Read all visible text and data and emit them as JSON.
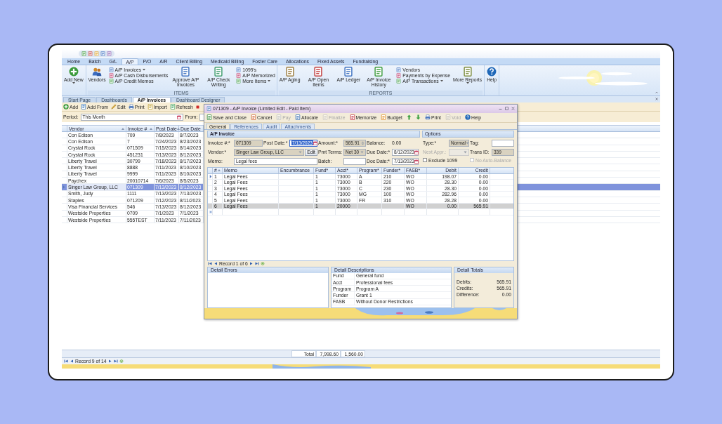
{
  "ribbon": {
    "tabs": [
      {
        "label": "Home",
        "selected": false
      },
      {
        "label": "Batch",
        "selected": false
      },
      {
        "label": "G/L",
        "selected": false
      },
      {
        "label": "A/P",
        "selected": true
      },
      {
        "label": "P/O",
        "selected": false
      },
      {
        "label": "A/R",
        "selected": false
      },
      {
        "label": "Client Billing",
        "selected": false
      },
      {
        "label": "Medicaid Billing",
        "selected": false
      },
      {
        "label": "Foster Care",
        "selected": false
      },
      {
        "label": "Allocations",
        "selected": false
      },
      {
        "label": "Fixed Assets",
        "selected": false
      },
      {
        "label": "Fundraising",
        "selected": false
      }
    ],
    "groups": [
      {
        "items": [
          {
            "kind": "large",
            "label": "Add New",
            "dropdown": true
          }
        ]
      },
      {
        "label": "ITEMS",
        "items": [
          {
            "kind": "large",
            "label": "Vendors",
            "dropdown": false
          },
          {
            "kind": "stack",
            "entries": [
              {
                "label": "A/P Invoices",
                "dropdown": true
              },
              {
                "label": "A/P Cash Disbursements",
                "dropdown": false
              },
              {
                "label": "A/P Credit Memos",
                "dropdown": false
              }
            ]
          },
          {
            "kind": "large",
            "label": "Approve A/P Invoices",
            "dropdown": false
          },
          {
            "kind": "large",
            "label": "A/P Check Writing",
            "dropdown": false
          },
          {
            "kind": "stack",
            "entries": [
              {
                "label": "1099's",
                "dropdown": false
              },
              {
                "label": "A/P Memorized",
                "dropdown": false
              },
              {
                "label": "More Items",
                "dropdown": true
              }
            ]
          }
        ]
      },
      {
        "label": "REPORTS",
        "items": [
          {
            "kind": "large",
            "label": "A/P Aging",
            "dropdown": false
          },
          {
            "kind": "large",
            "label": "A/P Open Items",
            "dropdown": false
          },
          {
            "kind": "large",
            "label": "A/P Ledger",
            "dropdown": false
          },
          {
            "kind": "large",
            "label": "A/P Invoice History",
            "dropdown": false
          },
          {
            "kind": "stack",
            "entries": [
              {
                "label": "Vendors",
                "dropdown": false
              },
              {
                "label": "Payments by Expense",
                "dropdown": false
              },
              {
                "label": "A/P Transactions",
                "dropdown": true
              }
            ]
          },
          {
            "kind": "large",
            "label": "More Reports",
            "dropdown": true
          }
        ]
      },
      {
        "items": [
          {
            "kind": "large",
            "label": "Help",
            "dropdown": false
          }
        ]
      }
    ]
  },
  "doc_tabs": [
    {
      "label": "Start Page",
      "selected": false
    },
    {
      "label": "Dashboards",
      "selected": false
    },
    {
      "label": "A/P Invoices",
      "selected": true
    },
    {
      "label": "Dashboard Designer",
      "selected": false
    }
  ],
  "toolbar": [
    {
      "label": "Add"
    },
    {
      "label": "Add From"
    },
    {
      "label": "Edit"
    },
    {
      "label": "Print"
    },
    {
      "label": "Import"
    },
    {
      "label": "Refresh"
    }
  ],
  "filter": {
    "period_label": "Period:",
    "period_value": "This Month",
    "from_label": "From:"
  },
  "list": {
    "columns": [
      {
        "label": "Vendor",
        "sortable": true
      },
      {
        "label": "Invoice #",
        "sortable": true
      },
      {
        "label": "Post Date",
        "sortable": true
      },
      {
        "label": "Due Date",
        "sortable": false
      }
    ],
    "rows": [
      {
        "vendor": "Con Edison",
        "invoice": "709",
        "post_date": "7/8/2023",
        "due_date": "8/7/2023",
        "selected": false
      },
      {
        "vendor": "Con Edison",
        "invoice": "7",
        "post_date": "7/24/2023",
        "due_date": "8/23/2023",
        "selected": false
      },
      {
        "vendor": "Crystal Rock",
        "invoice": "071509",
        "post_date": "7/15/2023",
        "due_date": "8/14/2023",
        "selected": false
      },
      {
        "vendor": "Crystal Rock",
        "invoice": "451231",
        "post_date": "7/13/2023",
        "due_date": "8/12/2023",
        "selected": false
      },
      {
        "vendor": "Liberty Travel",
        "invoice": "30799",
        "post_date": "7/18/2023",
        "due_date": "8/17/2023",
        "selected": false
      },
      {
        "vendor": "Liberty Travel",
        "invoice": "8888",
        "post_date": "7/11/2023",
        "due_date": "8/10/2023",
        "selected": false
      },
      {
        "vendor": "Liberty Travel",
        "invoice": "9999",
        "post_date": "7/11/2023",
        "due_date": "8/10/2023",
        "selected": false
      },
      {
        "vendor": "Paychex",
        "invoice": "20010714",
        "post_date": "7/6/2023",
        "due_date": "8/5/2023",
        "selected": false
      },
      {
        "vendor": "Singer Law Group, LLC",
        "invoice": "071309",
        "post_date": "7/13/2023",
        "due_date": "8/12/2023",
        "selected": true
      },
      {
        "vendor": "Smith, Judy",
        "invoice": "1111",
        "post_date": "7/13/2023",
        "due_date": "7/13/2023",
        "selected": false
      },
      {
        "vendor": "Staples",
        "invoice": "071209",
        "post_date": "7/12/2023",
        "due_date": "8/11/2023",
        "selected": false
      },
      {
        "vendor": "Visa Financial Services",
        "invoice": "546",
        "post_date": "7/13/2023",
        "due_date": "8/12/2023",
        "selected": false
      },
      {
        "vendor": "Westside Properties",
        "invoice": "0709",
        "post_date": "7/1/2023",
        "due_date": "7/1/2023",
        "selected": false
      },
      {
        "vendor": "Westside Properties",
        "invoice": "555TEST",
        "post_date": "7/11/2023",
        "due_date": "7/11/2023",
        "selected": false
      }
    ],
    "totals": {
      "label": "Total",
      "values": [
        "7,998.60",
        "1,560.00"
      ]
    },
    "status": "Record 9 of 14"
  },
  "dialog": {
    "title": "071309 - A/P Invoice (Limited Edit - Paid Item)",
    "toolbar": [
      {
        "label": "Save and Close",
        "disabled": false
      },
      {
        "label": "Cancel",
        "disabled": false
      },
      {
        "label": "Pay",
        "disabled": true
      },
      {
        "label": "Allocate",
        "disabled": false
      },
      {
        "label": "Finalize",
        "disabled": true
      },
      {
        "label": "Memorize",
        "disabled": false
      },
      {
        "label": "Budget",
        "disabled": false
      }
    ],
    "toolbar_right": [
      {
        "label": "Print",
        "disabled": false
      },
      {
        "label": "Void",
        "disabled": true
      },
      {
        "label": "Help",
        "disabled": false
      }
    ],
    "tabs": [
      {
        "label": "General",
        "selected": true
      },
      {
        "label": "References",
        "selected": false
      },
      {
        "label": "Audit",
        "selected": false
      },
      {
        "label": "Attachments",
        "selected": false
      }
    ],
    "invoice": {
      "title": "A/P Invoice",
      "fields": [
        {
          "label": "Invoice #:*",
          "value": "071309",
          "kind": "text",
          "locked": true,
          "highlighted": false
        },
        {
          "label": "Post Date:*",
          "value": "7/13/2023",
          "kind": "date",
          "locked": false,
          "highlighted": true
        },
        {
          "label": "Amount:*",
          "value": "565.91",
          "kind": "spin",
          "locked": true,
          "highlighted": false
        },
        {
          "label": "Balance:",
          "value": "0.00",
          "kind": "plain"
        },
        {
          "label": "Vendor:*",
          "value": "Singer Law Group, LLC",
          "kind": "dropdown",
          "button": "Edit",
          "locked": true,
          "highlighted": false
        },
        {
          "label": "Pmt Terms:",
          "value": "Net 30",
          "kind": "dropdown",
          "locked": true,
          "highlighted": false
        },
        {
          "label": "Due Date:*",
          "value": "8/12/2023",
          "kind": "date",
          "locked": false,
          "highlighted": false
        },
        {
          "label": "Memo:",
          "value": "Legal fees",
          "kind": "text",
          "locked": false,
          "highlighted": false
        },
        {
          "label": "Batch:",
          "kind": "text",
          "locked": false,
          "highlighted": false
        },
        {
          "label": "Doc Date:*",
          "value": "7/13/2023",
          "kind": "date",
          "locked": false,
          "highlighted": false
        }
      ]
    },
    "options": {
      "title": "Options",
      "rows": [
        [
          {
            "label": "Type:*",
            "value": "Normal",
            "kind": "dropdown",
            "locked": true,
            "disabled": false
          },
          {
            "label": "Tag:",
            "kind": "text",
            "locked": false,
            "disabled": false
          }
        ],
        [
          {
            "label": "Next Appr.:",
            "kind": "dropdown",
            "locked": true,
            "disabled": true
          },
          {
            "label": "Trans ID:",
            "value": "339",
            "kind": "text",
            "locked": true,
            "disabled": false
          }
        ],
        [
          {
            "label": "Exclude 1099",
            "kind": "checkbox",
            "checked": false,
            "disabled": false
          },
          {
            "label": "No Auto-Balance",
            "kind": "checkbox",
            "checked": false,
            "disabled": true
          }
        ]
      ]
    },
    "grid": {
      "columns": [
        {
          "label": "#",
          "sortable": true
        },
        {
          "label": "Memo",
          "sortable": false
        },
        {
          "label": "Encumbrance",
          "sortable": false
        },
        {
          "label": "Fund*",
          "sortable": false
        },
        {
          "label": "Acct*",
          "sortable": false
        },
        {
          "label": "Program*",
          "sortable": false
        },
        {
          "label": "Funder*",
          "sortable": false
        },
        {
          "label": "FASB*",
          "sortable": false
        },
        {
          "label": "Debit",
          "sortable": false
        },
        {
          "label": "Credit",
          "sortable": false
        }
      ],
      "rows": [
        {
          "number": "1",
          "memo": "Legal Fees",
          "fund": "1",
          "acct": "73000",
          "program": "A",
          "funder": "210",
          "fasb": "WO",
          "debit": "198.07",
          "credit": "0.00",
          "current": true,
          "selected": false
        },
        {
          "number": "2",
          "memo": "Legal Fees",
          "fund": "1",
          "acct": "73000",
          "program": "B",
          "funder": "220",
          "fasb": "WO",
          "debit": "28.30",
          "credit": "0.00",
          "current": false,
          "selected": false
        },
        {
          "number": "3",
          "memo": "Legal Fees",
          "fund": "1",
          "acct": "73000",
          "program": "C",
          "funder": "230",
          "fasb": "WO",
          "debit": "28.30",
          "credit": "0.00",
          "current": false,
          "selected": false
        },
        {
          "number": "4",
          "memo": "Legal Fees",
          "fund": "1",
          "acct": "73000",
          "program": "MG",
          "funder": "100",
          "fasb": "WO",
          "debit": "282.96",
          "credit": "0.00",
          "current": false,
          "selected": false
        },
        {
          "number": "5",
          "memo": "Legal Fees",
          "fund": "1",
          "acct": "73000",
          "program": "FR",
          "funder": "310",
          "fasb": "WO",
          "debit": "28.28",
          "credit": "0.00",
          "current": false,
          "selected": false
        },
        {
          "number": "6",
          "memo": "Legal Fees",
          "fund": "1",
          "acct": "20000",
          "fasb": "WO",
          "debit": "0.00",
          "credit": "565.91",
          "current": false,
          "selected": true
        }
      ],
      "status": "Record 1 of 6"
    },
    "errors": {
      "title": "Detail Errors"
    },
    "descriptions": {
      "title": "Detail Descriptions",
      "rows": [
        {
          "field": "Fund",
          "description": "General fund"
        },
        {
          "field": "Acct",
          "description": "Professional fees"
        },
        {
          "field": "Program",
          "description": "Program A"
        },
        {
          "field": "Funder",
          "description": "Grant 1"
        },
        {
          "field": "FASB",
          "description": "Without Donor Restrictions"
        }
      ]
    },
    "totals": {
      "title": "Detail Totals",
      "rows": [
        {
          "label": "Debits:",
          "value": "565.91"
        },
        {
          "label": "Credits:",
          "value": "565.91"
        },
        {
          "label": "Difference:",
          "value": "0.00"
        }
      ]
    }
  }
}
